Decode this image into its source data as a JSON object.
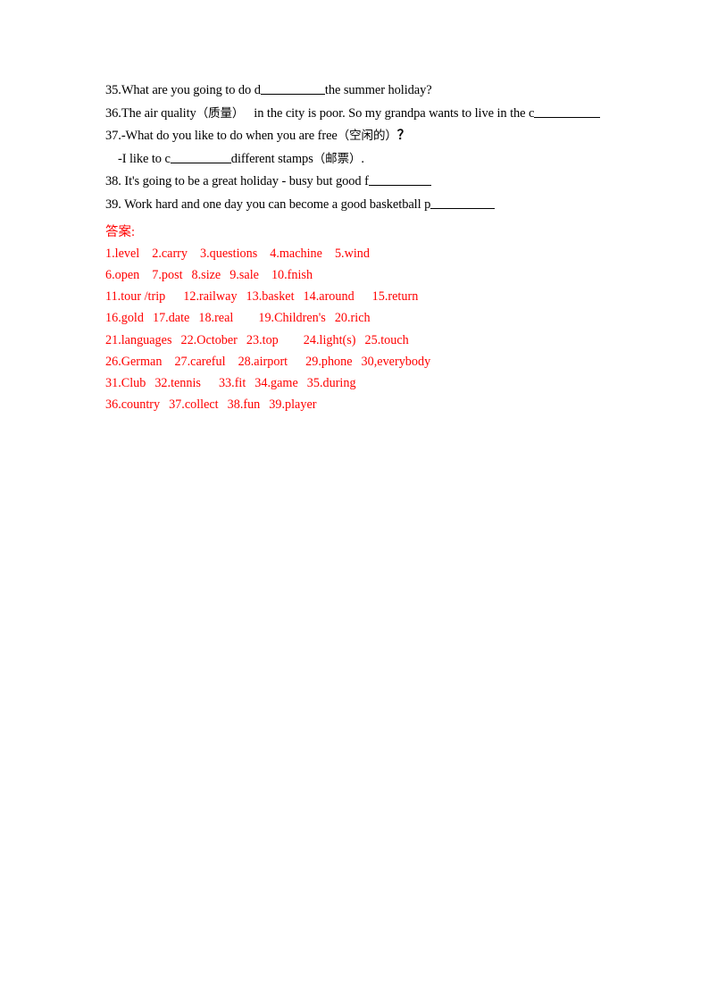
{
  "document": {
    "type": "english-worksheet-answer-key",
    "text_color": "#000000",
    "answer_color": "#FF0000"
  },
  "questions": [
    {
      "id": "q35",
      "pre": "35.What are you going to do d",
      "blank": true,
      "post": "the summer holiday?"
    },
    {
      "id": "q36",
      "pre": "36.The air quality",
      "cn": "（质量）",
      "mid": "in the city is poor. So my grandpa wants to live in the c",
      "blank": true,
      "post": ""
    },
    {
      "id": "q37",
      "pre": "37.-What do you like to do when you are free",
      "cn": "（空闲的）",
      "qmark": "？",
      "post": ""
    },
    {
      "id": "q37b",
      "indent": true,
      "pre": "-I like to c",
      "blank": true,
      "mid": "different stamps",
      "cn": "（邮票）",
      "post": "."
    },
    {
      "id": "q38",
      "pre": "38. It's going to be a great holiday - busy but good f",
      "blank": true,
      "post": ""
    },
    {
      "id": "q39",
      "pre": "39. Work hard and one day you can become a good basketball p",
      "blank": true,
      "post": ""
    }
  ],
  "answers": {
    "heading": "答案",
    "heading_colon": ":",
    "lines": [
      [
        "1.level",
        "2.carry",
        "3.questions",
        "4.machine",
        "5.wind"
      ],
      [
        "6.open",
        "7.post",
        "8.size",
        "9.sale",
        "10.fnish"
      ],
      [
        "11.tour /trip",
        "12.railway",
        "13.basket",
        "14.around",
        "15.return"
      ],
      [
        "16.gold",
        "17.date",
        "18.real",
        "19.Children's",
        "20.rich"
      ],
      [
        "21.languages",
        "22.October",
        "23.top",
        "24.light(s)",
        "25.touch"
      ],
      [
        "26.German",
        "27.careful",
        "28.airport",
        "29.phone",
        "30,everybody"
      ],
      [
        "31.Club",
        "32.tennis",
        "33.fit",
        "34.game",
        "35.during"
      ],
      [
        "36.country",
        "37.collect",
        "38.fun",
        "39.player"
      ]
    ]
  }
}
